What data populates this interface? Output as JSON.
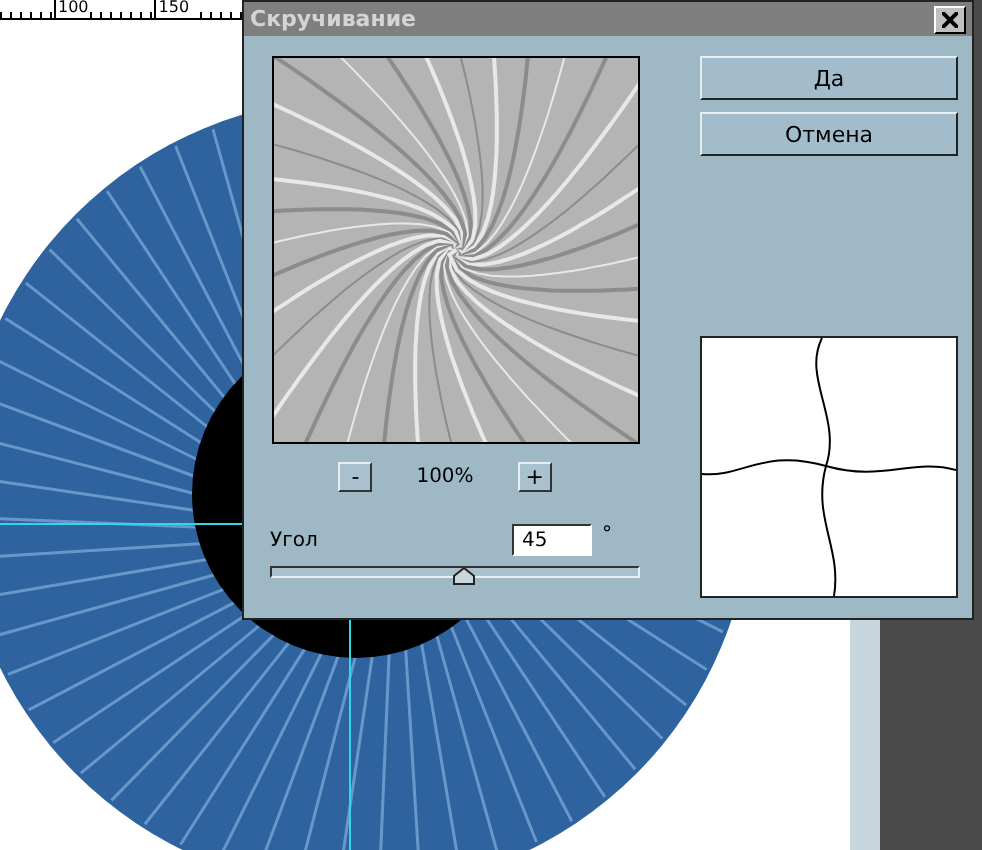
{
  "ruler": {
    "labels": [
      "100",
      "150"
    ]
  },
  "dialog": {
    "title": "Скручивание",
    "buttons": [
      "Да",
      "Отмена"
    ],
    "zoom": {
      "minus": "-",
      "value": "100%",
      "plus": "+"
    },
    "angle": {
      "label": "Угол",
      "value": "45",
      "unit": "°",
      "level": 0.525
    }
  }
}
